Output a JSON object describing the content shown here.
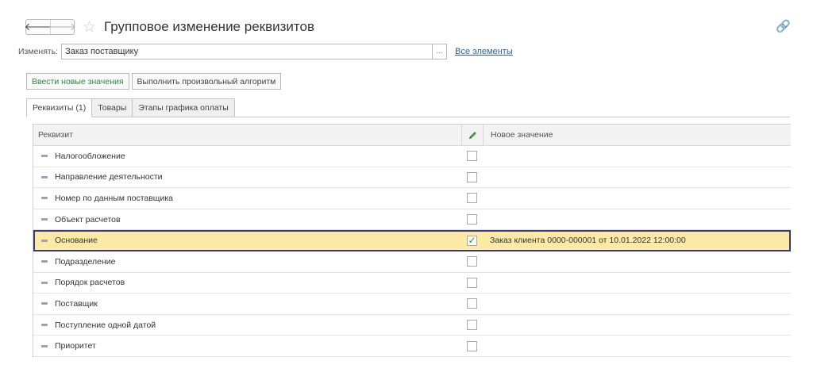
{
  "header": {
    "back_icon": "arrow-left-icon",
    "forward_icon": "arrow-right-icon",
    "favorite_icon": "star-icon",
    "title": "Групповое изменение реквизитов",
    "link_icon": "link-icon"
  },
  "change": {
    "label": "Изменять:",
    "value": "Заказ поставщику",
    "choose_label": "...",
    "all_elements_link": "Все элементы"
  },
  "actions": {
    "enter_new_values": "Ввести новые значения",
    "run_algorithm": "Выполнить произвольный алгоритм"
  },
  "tabs": [
    {
      "label": "Реквизиты (1)",
      "active": true
    },
    {
      "label": "Товары",
      "active": false
    },
    {
      "label": "Этапы графика оплаты",
      "active": false
    }
  ],
  "table": {
    "headers": {
      "attribute": "Реквизит",
      "edit_icon": "pencil-icon",
      "new_value": "Новое значение"
    },
    "rows": [
      {
        "attribute": "Налогообложение",
        "checked": false,
        "new_value": ""
      },
      {
        "attribute": "Направление деятельности",
        "checked": false,
        "new_value": ""
      },
      {
        "attribute": "Номер по данным поставщика",
        "checked": false,
        "new_value": ""
      },
      {
        "attribute": "Объект расчетов",
        "checked": false,
        "new_value": ""
      },
      {
        "attribute": "Основание",
        "checked": true,
        "new_value": "Заказ клиента 0000-000001 от 10.01.2022 12:00:00",
        "selected": true
      },
      {
        "attribute": "Подразделение",
        "checked": false,
        "new_value": ""
      },
      {
        "attribute": "Порядок расчетов",
        "checked": false,
        "new_value": ""
      },
      {
        "attribute": "Поставщик",
        "checked": false,
        "new_value": ""
      },
      {
        "attribute": "Поступление одной датой",
        "checked": false,
        "new_value": ""
      },
      {
        "attribute": "Приоритет",
        "checked": false,
        "new_value": ""
      }
    ]
  },
  "colors": {
    "accent_green": "#2d8a3d",
    "link_blue": "#2c5fa8",
    "selection_fill": "#fbe9a5",
    "selection_border": "#3b3973"
  }
}
